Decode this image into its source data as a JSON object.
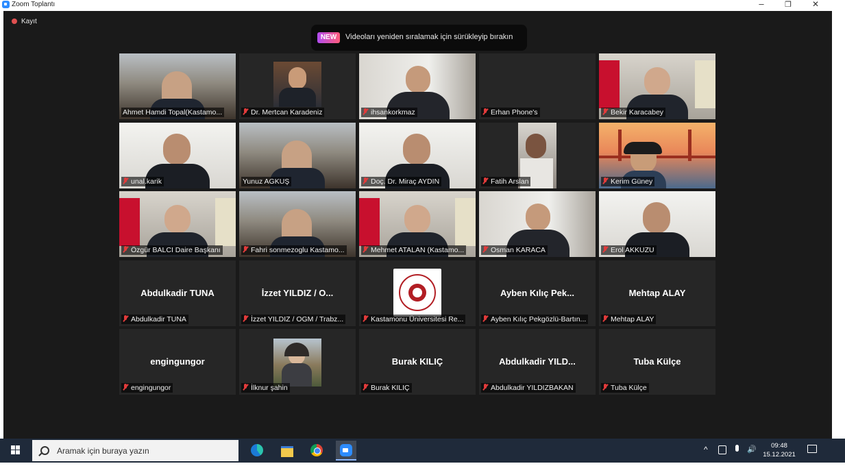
{
  "window": {
    "title": "Zoom Toplantı",
    "minimize": "–",
    "restore": "❐",
    "close": "✕"
  },
  "recording": {
    "label": "Kayıt"
  },
  "banner": {
    "badge": "NEW",
    "message": "Videoları yeniden sıralamak için sürükleyip bırakın"
  },
  "tiles": [
    {
      "name": "Ahmet Hamdi Topal(Kastamo...",
      "big": "",
      "muted": false,
      "active": true,
      "video": "office"
    },
    {
      "name": "Dr. Mertcan Karadeniz",
      "big": "",
      "muted": true,
      "video": "small-portrait"
    },
    {
      "name": "ihsankorkmaz",
      "big": "",
      "muted": true,
      "video": "window"
    },
    {
      "name": "Erhan Phone's",
      "big": "",
      "muted": true,
      "video": "none"
    },
    {
      "name": "Bekir Karacabey",
      "big": "",
      "muted": true,
      "video": "flags"
    },
    {
      "name": "unal.karik",
      "big": "",
      "muted": true,
      "video": "bright"
    },
    {
      "name": "Yunuz AGKUŞ",
      "big": "",
      "muted": false,
      "video": "office"
    },
    {
      "name": "Doç. Dr. Miraç AYDIN",
      "big": "",
      "muted": true,
      "video": "bright"
    },
    {
      "name": "Fatih Arslan",
      "big": "",
      "muted": true,
      "video": "phone"
    },
    {
      "name": "Kerim Güney",
      "big": "",
      "muted": true,
      "video": "bridge"
    },
    {
      "name": "Özgür BALCI Daire Başkanı",
      "big": "",
      "muted": true,
      "video": "flags"
    },
    {
      "name": "Fahri sonmezoglu Kastamo...",
      "big": "",
      "muted": true,
      "video": "office"
    },
    {
      "name": "Mehmet ATALAN (Kastamo...",
      "big": "",
      "muted": true,
      "video": "flags"
    },
    {
      "name": "Osman KARACA",
      "big": "",
      "muted": true,
      "video": "window"
    },
    {
      "name": "Erol AKKUZU",
      "big": "",
      "muted": true,
      "video": "bright"
    },
    {
      "name": "Abdulkadir TUNA",
      "big": "Abdulkadir TUNA",
      "muted": true,
      "video": "none"
    },
    {
      "name": "İzzet YILDIZ / OGM / Trabz...",
      "big": "İzzet YILDIZ / O...",
      "muted": true,
      "video": "none"
    },
    {
      "name": "Kastamonu Üniversitesi Re...",
      "big": "",
      "muted": true,
      "video": "logo"
    },
    {
      "name": "Ayben Kılıç Pekgözlü-Bartın...",
      "big": "Ayben Kılıç Pek...",
      "muted": true,
      "video": "none"
    },
    {
      "name": "Mehtap ALAY",
      "big": "Mehtap ALAY",
      "muted": true,
      "video": "none"
    },
    {
      "name": "engingungor",
      "big": "engingungor",
      "muted": true,
      "video": "none"
    },
    {
      "name": "İlknur şahin",
      "big": "",
      "muted": true,
      "video": "photo"
    },
    {
      "name": "Burak KILIÇ",
      "big": "Burak KILIÇ",
      "muted": true,
      "video": "none"
    },
    {
      "name": "Abdulkadir YILDIZBAKAN",
      "big": "Abdulkadir YILD...",
      "muted": true,
      "video": "none"
    },
    {
      "name": "Tuba Külçe",
      "big": "Tuba Külçe",
      "muted": true,
      "video": "none"
    }
  ],
  "taskbar": {
    "search_placeholder": "Aramak için buraya yazın",
    "time": "09:48",
    "date": "15.12.2021"
  },
  "colors": {
    "stage": "#1a1a1a",
    "tile": "#262626",
    "active_border": "#d9ec5f",
    "muted": "#e23b3b",
    "taskbar": "#1f2a3a"
  }
}
